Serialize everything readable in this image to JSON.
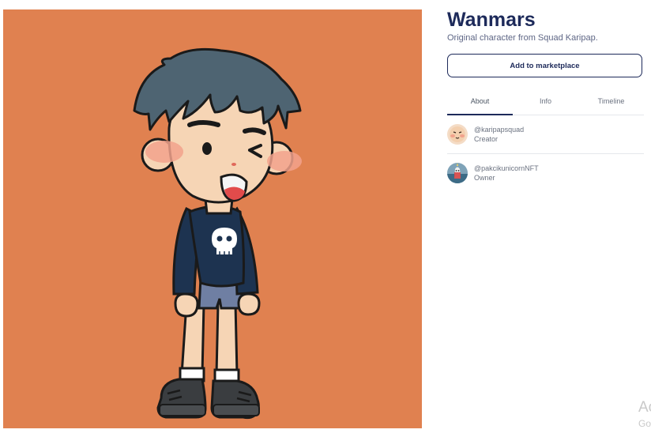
{
  "nft": {
    "title": "Wanmars",
    "description": "Original character from Squad Karipap.",
    "artwork_background": "#e08150"
  },
  "actions": {
    "add_to_marketplace": "Add to marketplace"
  },
  "tabs": [
    {
      "label": "About",
      "active": true
    },
    {
      "label": "Info",
      "active": false
    },
    {
      "label": "Timeline",
      "active": false
    }
  ],
  "people": [
    {
      "handle": "@karipapsquad",
      "role": "Creator",
      "avatar": "karipap-face-avatar"
    },
    {
      "handle": "@pakcikunicornNFT",
      "role": "Owner",
      "avatar": "unicorn-avatar"
    }
  ],
  "watermark": {
    "line1": "Ac",
    "line2": "Go"
  },
  "colors": {
    "accent": "#1d2a5a",
    "muted_text": "#6b7280",
    "divider": "#e5e7eb"
  }
}
